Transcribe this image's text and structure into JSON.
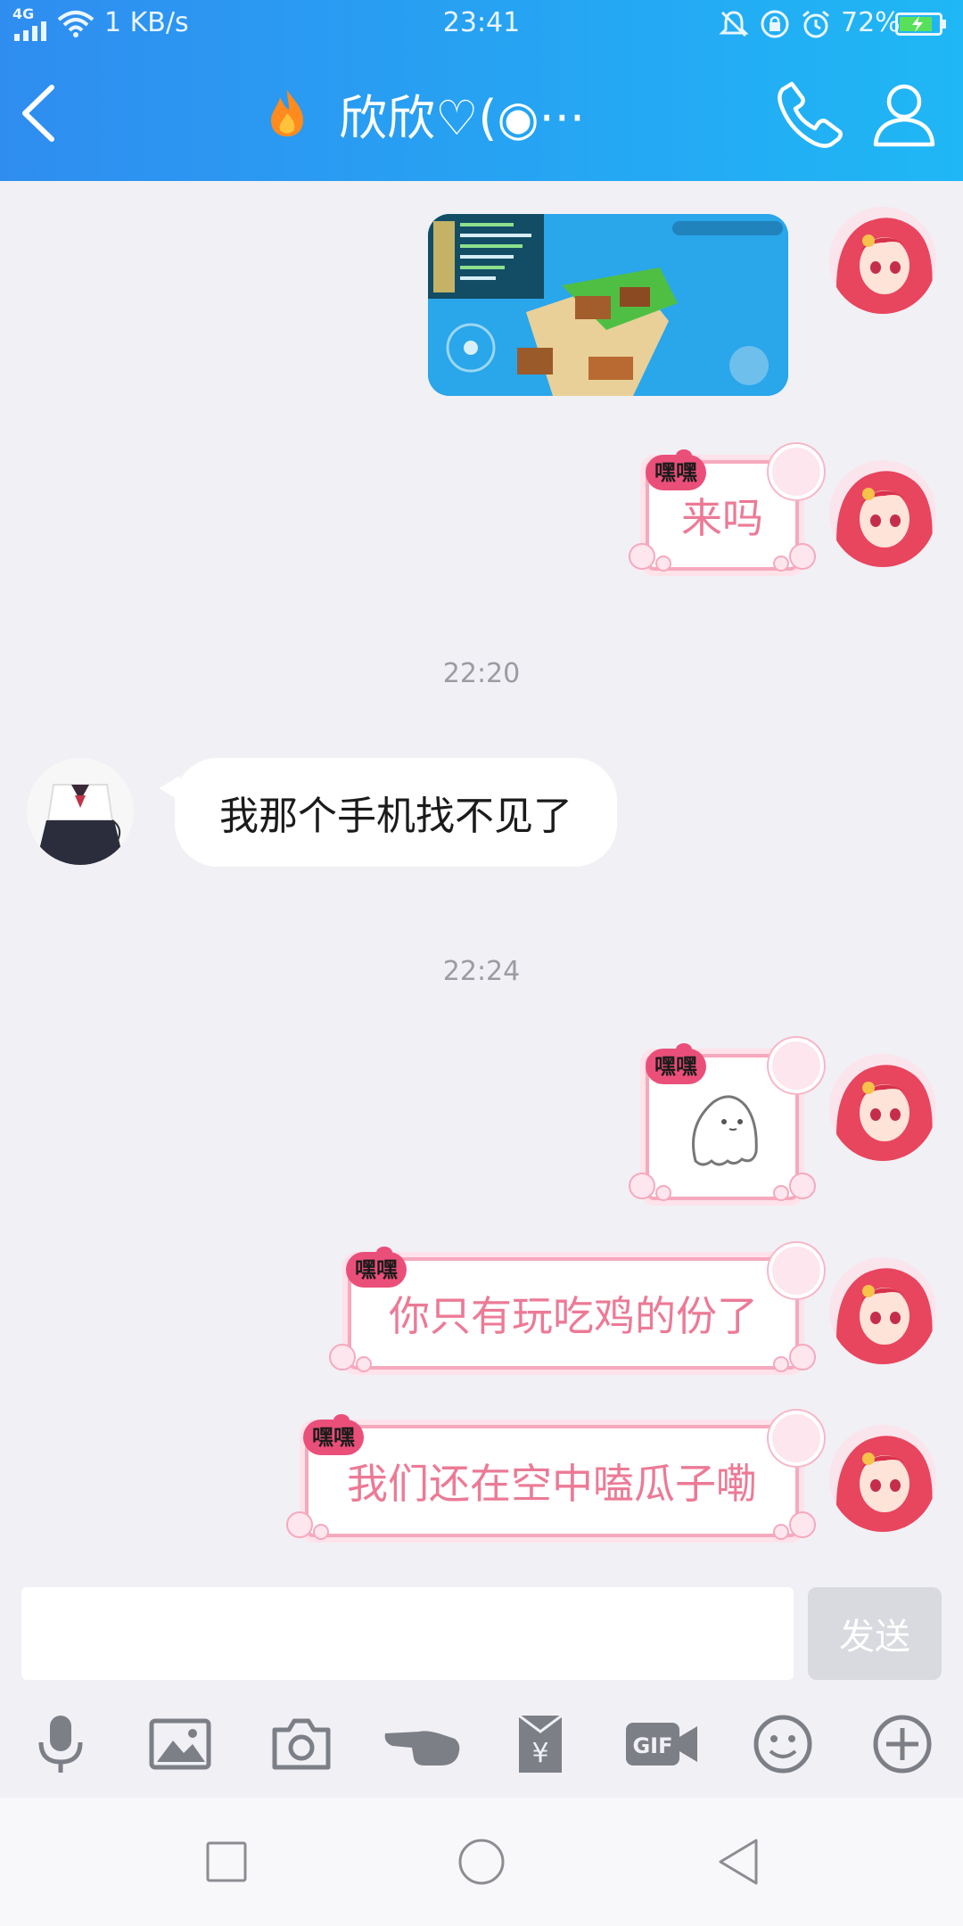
{
  "status_bar": {
    "net_type": "4G",
    "speed": "1 KB/s",
    "time": "23:41",
    "battery_pct": "72%",
    "icons": [
      "signal-icon",
      "wifi-icon",
      "mute-bell-icon",
      "lock-rotation-icon",
      "alarm-icon",
      "battery-charging-icon"
    ]
  },
  "header": {
    "title": "欣欣♡(◉···",
    "icons": [
      "back-arrow-icon",
      "flame-icon",
      "phone-icon",
      "profile-icon"
    ]
  },
  "messages": [
    {
      "type": "image",
      "side": "right",
      "description_icon": "game-screenshot"
    },
    {
      "type": "text",
      "side": "right",
      "tag": "嘿嘿",
      "text": "来吗"
    },
    {
      "type": "time",
      "text": "22:20"
    },
    {
      "type": "text",
      "side": "left",
      "text": "我那个手机找不见了"
    },
    {
      "type": "time",
      "text": "22:24"
    },
    {
      "type": "sticker",
      "side": "right",
      "tag": "嘿嘿",
      "sticker_icon": "ghost-icon"
    },
    {
      "type": "text",
      "side": "right",
      "tag": "嘿嘿",
      "text": "你只有玩吃鸡的份了"
    },
    {
      "type": "text",
      "side": "right",
      "tag": "嘿嘿",
      "text": "我们还在空中嗑瓜子嘞"
    }
  ],
  "input": {
    "value": "",
    "placeholder": "",
    "send_label": "发送"
  },
  "toolbar": [
    "microphone-icon",
    "image-icon",
    "camera-icon",
    "poke-hand-icon",
    "red-packet-icon",
    "gif-icon",
    "emoji-icon",
    "plus-icon"
  ],
  "system_nav": [
    "recent-apps-icon",
    "home-icon",
    "back-icon"
  ],
  "colors": {
    "header_start": "#2f8df0",
    "header_end": "#1fb7f5",
    "bubble_pink": "#ec7a96",
    "tag_pink": "#ea4f7a",
    "chat_bg": "#f0f0f5"
  }
}
